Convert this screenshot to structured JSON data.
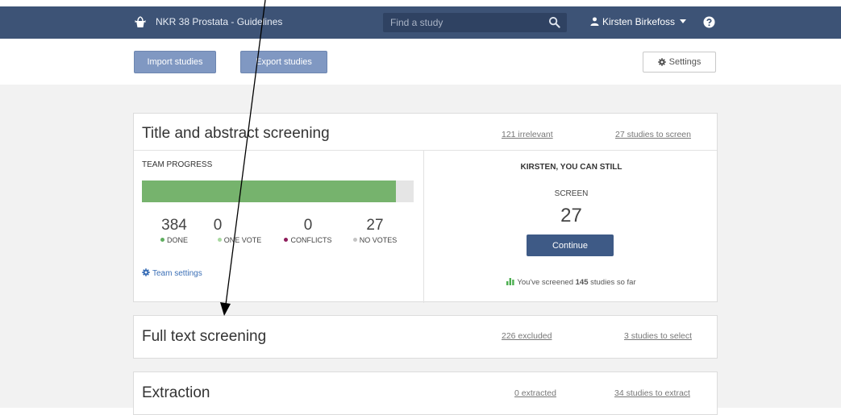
{
  "navbar": {
    "brand": "NKR 38 Prostata - Guidelines",
    "search_placeholder": "Find a study",
    "user_name": "Kirsten Birkefoss",
    "icons": [
      "logo-icon",
      "search-icon",
      "user-icon",
      "caret-down-icon",
      "help-icon"
    ]
  },
  "toolbar": {
    "import_label": "Import studies",
    "export_label": "Export studies",
    "settings_label": "Settings"
  },
  "title_abstract": {
    "title": "Title and abstract screening",
    "irrelevant_link": "121 irrelevant",
    "to_screen_link": "27 studies to screen",
    "team_progress_label": "TEAM PROGRESS",
    "progress_done_fraction": 0.934,
    "stats": [
      {
        "value": "384",
        "label": "DONE",
        "color": "#5fae5f"
      },
      {
        "value": "0",
        "label": "ONE VOTE",
        "color": "#a8d8a0"
      },
      {
        "value": "0",
        "label": "CONFLICTS",
        "color": "#8e1d5b"
      },
      {
        "value": "27",
        "label": "NO VOTES",
        "color": "#c4c4c4"
      }
    ],
    "team_settings_label": "Team settings",
    "kirsten_heading": "KIRSTEN, YOU CAN STILL",
    "screen_label": "SCREEN",
    "screen_count": "27",
    "continue_label": "Continue",
    "screened_prefix": "You've screened",
    "screened_count": "145",
    "screened_suffix": "studies so far"
  },
  "full_text": {
    "title": "Full text screening",
    "excluded_link": "226 excluded",
    "select_link": "3 studies to select"
  },
  "extraction": {
    "title": "Extraction",
    "extracted_link": "0 extracted",
    "extract_link": "34 studies to extract"
  },
  "colors": {
    "navbar": "#3d5376",
    "progress": "#76b36d",
    "button_blue": "#8098c2",
    "continue": "#3e5a86"
  }
}
